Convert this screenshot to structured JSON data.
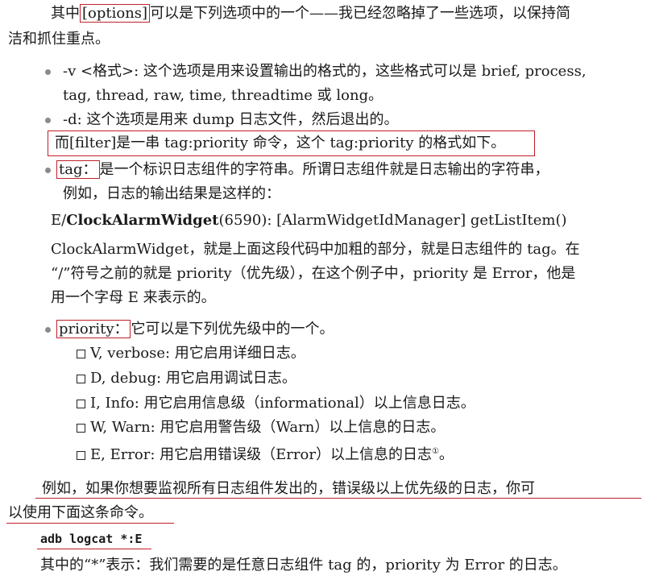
{
  "intro": {
    "pre": "其中",
    "options_word": "[options]",
    "post": "可以是下列选项中的一个——我已经忽略掉了一些选项，以保持简",
    "line2": "洁和抓住重点。"
  },
  "option_v": {
    "line1": "-v <格式>: 这个选项是用来设置输出的格式的，这些格式可以是 brief, process,",
    "line2": "tag, thread, raw, time, threadtime 或 long。"
  },
  "option_d": {
    "line1": "-d: 这个选项是用来 dump 日志文件，然后退出的。"
  },
  "filter_line": "而[filter]是一串 tag:priority 命令，这个 tag:priority 的格式如下。",
  "tag_item": {
    "tag_word": "tag：",
    "post": "是一个标识日志组件的字符串。所谓日志组件就是日志输出的字符串，",
    "line2": "例如，日志的输出结果是这样的："
  },
  "log_example": {
    "prefix": "E/",
    "bold_part": "ClockAlarmWidget",
    "rest": "(6590): [AlarmWidgetIdManager] getListItem()"
  },
  "explain": {
    "line1": "ClockAlarmWidget，就是上面这段代码中加粗的部分，就是日志组件的 tag。在",
    "line2": "“/”符号之前的就是 priority（优先级），在这个例子中，priority 是 Error，他是",
    "line3": "用一个字母 E 来表示的。"
  },
  "priority_item": {
    "priority_word": "priority：",
    "post": "它可以是下列优先级中的一个。"
  },
  "levels": [
    {
      "text": "V, verbose: 用它启用详细日志。"
    },
    {
      "text": "D, debug: 用它启用调试日志。"
    },
    {
      "text": "I, Info: 用它启用信息级（informational）以上信息日志。"
    },
    {
      "text": "W, Warn: 用它启用警告级（Warn）以上信息的日志。"
    },
    {
      "text": "E, Error: 用它启用错误级（Error）以上信息的日志",
      "note": "①",
      "end": "。"
    }
  ],
  "example": {
    "line1": "例如，如果你想要监视所有日志组件发出的，错误级以上优先级的日志，你可",
    "line2": "以使用下面这条命令。"
  },
  "command": "adb logcat *:E",
  "final_line": "其中的“*”表示：我们需要的是任意日志组件 tag 的，priority 为 Error 的日志。",
  "colors": {
    "highlight": "#c0202a",
    "bullet": "#8a8a8a",
    "text": "#1a1a1a"
  }
}
